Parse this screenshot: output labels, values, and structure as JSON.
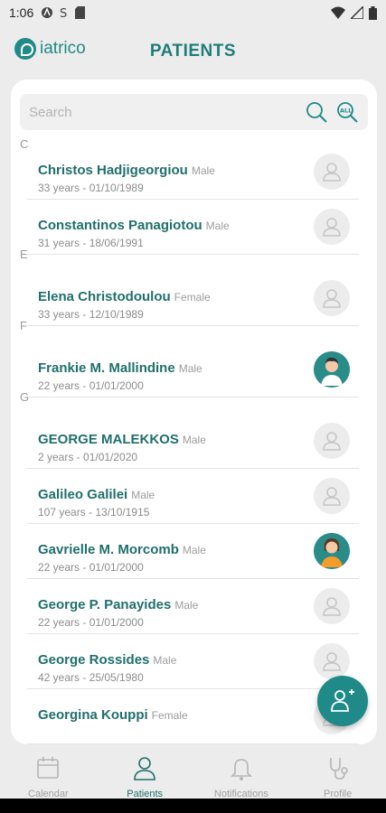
{
  "status_bar": {
    "time": "1:06"
  },
  "header": {
    "logo_text": "iatrico",
    "title": "PATIENTS"
  },
  "search": {
    "placeholder": "Search",
    "all_label": "ALL"
  },
  "sections": [
    {
      "letter": "C",
      "patients": [
        {
          "name": "Christos Hadjigeorgiou",
          "gender": "Male",
          "meta": "33 years - 01/10/1989",
          "avatar": "placeholder"
        },
        {
          "name": "Constantinos Panagiotou",
          "gender": "Male",
          "meta": "31 years - 18/06/1991",
          "avatar": "placeholder"
        }
      ]
    },
    {
      "letter": "E",
      "patients": [
        {
          "name": "Elena Christodoulou",
          "gender": "Female",
          "meta": "33 years - 12/10/1989",
          "avatar": "placeholder"
        }
      ]
    },
    {
      "letter": "F",
      "patients": [
        {
          "name": "Frankie M. Mallindine",
          "gender": "Male",
          "meta": "22 years - 01/01/2000",
          "avatar": "male-photo"
        }
      ]
    },
    {
      "letter": "G",
      "patients": [
        {
          "name": "GEORGE MALEKKOS",
          "gender": "Male",
          "meta": "2 years - 01/01/2020",
          "avatar": "placeholder"
        },
        {
          "name": "Galileo Galilei",
          "gender": "Male",
          "meta": "107 years - 13/10/1915",
          "avatar": "placeholder"
        },
        {
          "name": "Gavrielle M. Morcomb",
          "gender": "Male",
          "meta": "22 years - 01/01/2000",
          "avatar": "female-photo"
        },
        {
          "name": "George P. Panayides",
          "gender": "Male",
          "meta": "22 years - 01/01/2000",
          "avatar": "placeholder"
        },
        {
          "name": "George Rossides",
          "gender": "Male",
          "meta": "42 years - 25/05/1980",
          "avatar": "placeholder"
        },
        {
          "name": "Georgina Kouppi",
          "gender": "Female",
          "meta": "",
          "avatar": "placeholder"
        }
      ]
    }
  ],
  "nav": [
    {
      "label": "Calendar",
      "icon": "calendar-icon",
      "active": false
    },
    {
      "label": "Patients",
      "icon": "person-icon",
      "active": true
    },
    {
      "label": "Notifications",
      "icon": "bell-icon",
      "active": false
    },
    {
      "label": "Profile",
      "icon": "stethoscope-icon",
      "active": false
    }
  ],
  "colors": {
    "accent": "#1f8a87",
    "name_text": "#1f6f6c"
  }
}
